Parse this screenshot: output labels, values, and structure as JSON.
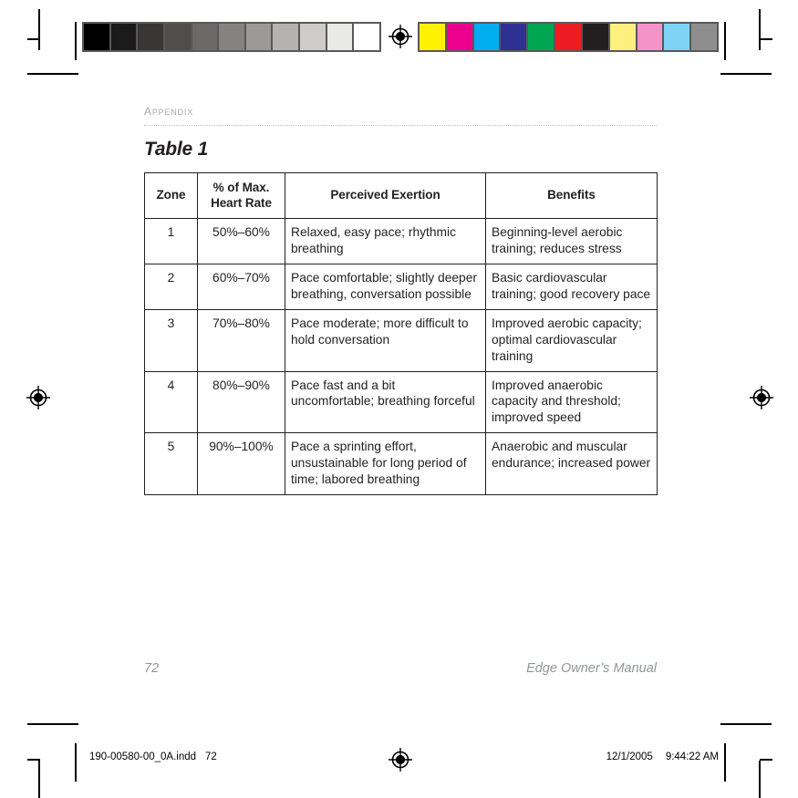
{
  "document": {
    "section_label": "Appendix",
    "table_title": "Table 1",
    "page_number": "72",
    "manual_name": "Edge Owner’s Manual"
  },
  "table": {
    "headers": {
      "zone": "Zone",
      "percent_line1": "% of Max.",
      "percent_line2": "Heart Rate",
      "exertion": "Perceived Exertion",
      "benefits": "Benefits"
    },
    "rows": [
      {
        "zone": "1",
        "percent": "50%–60%",
        "exertion": "Relaxed, easy pace; rhythmic breathing",
        "benefits": "Beginning-level aerobic training; reduces stress"
      },
      {
        "zone": "2",
        "percent": "60%–70%",
        "exertion": "Pace comfortable; slightly deeper breathing, conversation possible",
        "benefits": "Basic cardiovascular training; good recovery pace"
      },
      {
        "zone": "3",
        "percent": "70%–80%",
        "exertion": "Pace moderate; more difficult to hold conversation",
        "benefits": "Improved aerobic capacity; optimal cardiovascular training"
      },
      {
        "zone": "4",
        "percent": "80%–90%",
        "exertion": "Pace fast and a bit uncomfortable; breathing forceful",
        "benefits": "Improved anaerobic capacity and threshold; improved speed"
      },
      {
        "zone": "5",
        "percent": "90%–100%",
        "exertion": "Pace a sprinting effort, unsustainable for long period of time; labored breathing",
        "benefits": "Anaerobic and muscular endurance; increased power"
      }
    ]
  },
  "print_slug": {
    "filename": "190-00580-00_0A.indd",
    "page": "72",
    "date": "12/1/2005",
    "time": "9:44:22 AM"
  },
  "calibration": {
    "grayscale_patches": [
      "#000000",
      "#1c1b1b",
      "#383736",
      "#4f4e4d",
      "#6b6a69",
      "#848382",
      "#9b9a99",
      "#b4b3b2",
      "#cdcccb",
      "#e9e9e8",
      "#ffffff"
    ],
    "color_patches": [
      "#fff200",
      "#ec008c",
      "#00aeef",
      "#2e3192",
      "#00a651",
      "#ed1c24",
      "#231f20",
      "#fdf07f",
      "#f493c8",
      "#7fd4f5",
      "#8e8e8e"
    ]
  }
}
